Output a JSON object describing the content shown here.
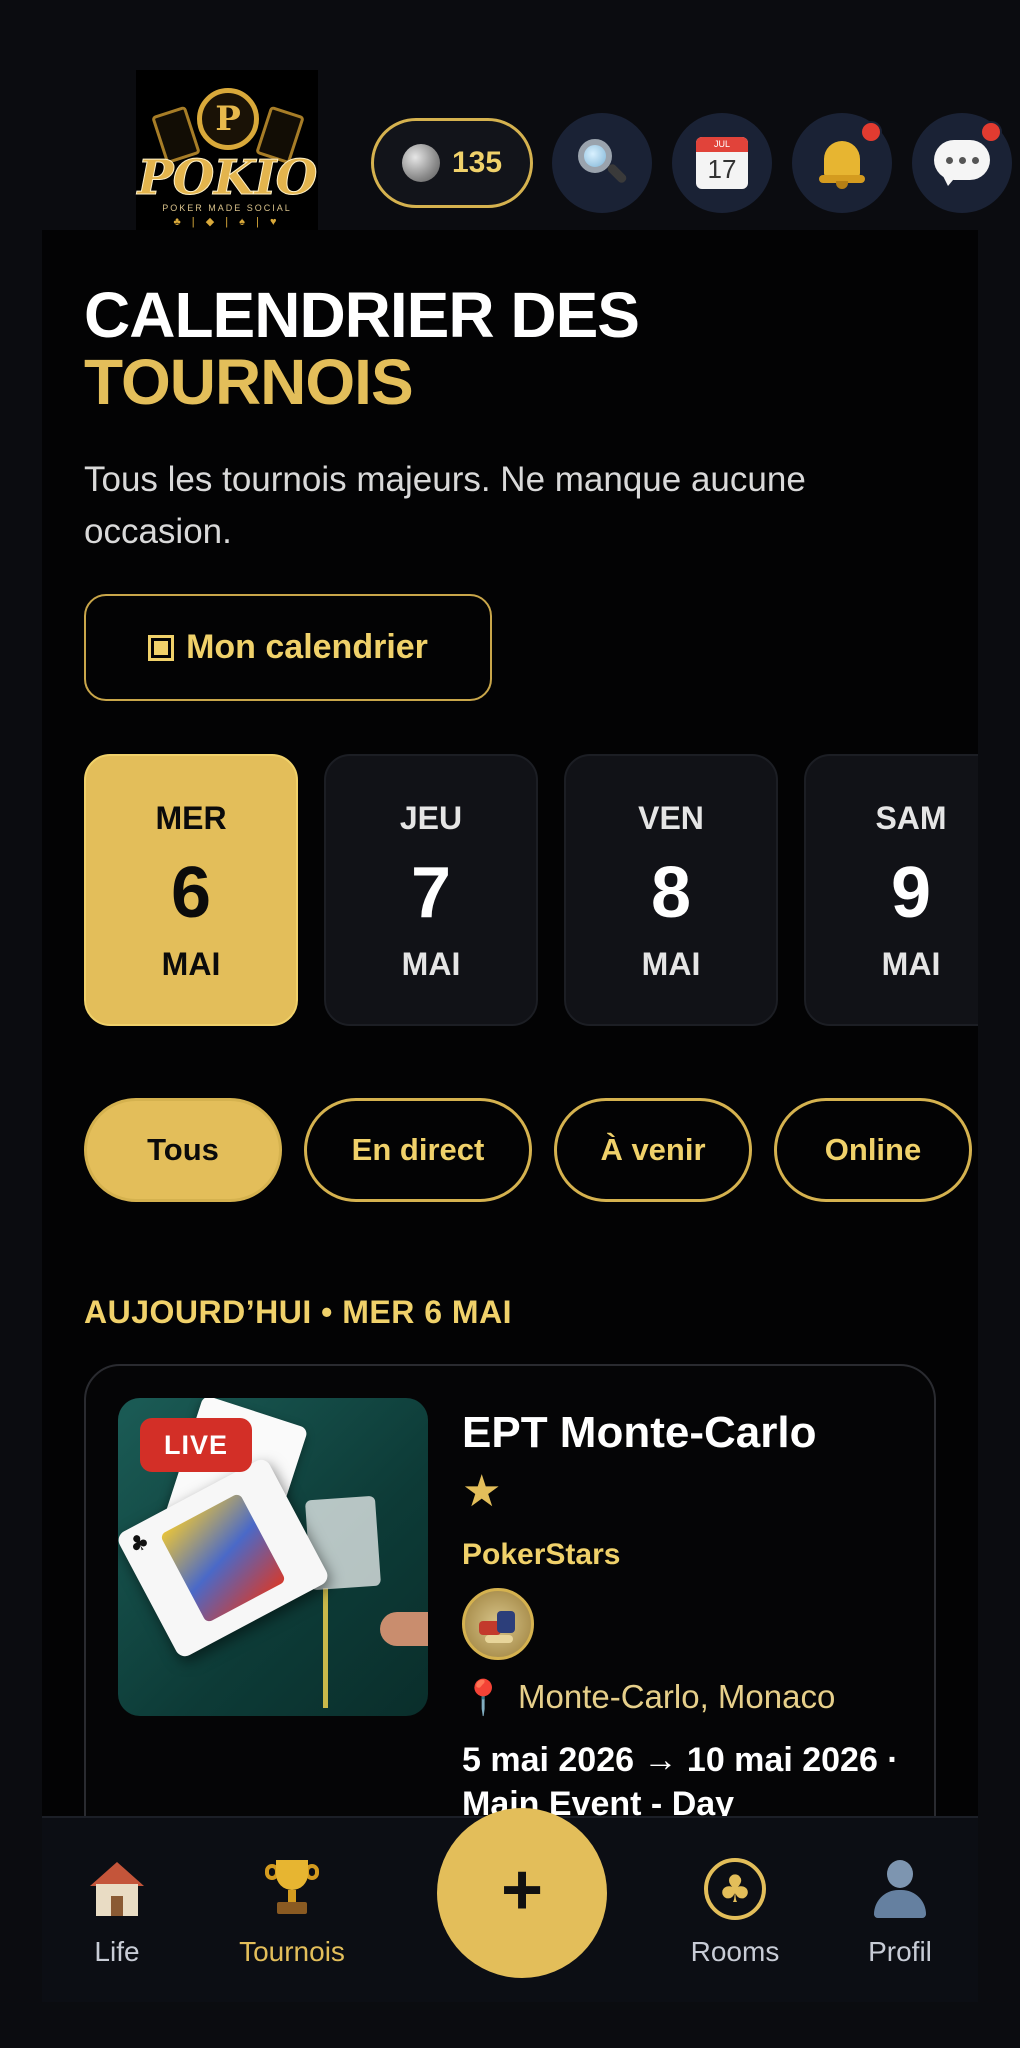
{
  "header": {
    "logo": {
      "chip_letter": "P",
      "wordmark": "POKIO",
      "tagline": "POKER MADE SOCIAL"
    },
    "coins": {
      "amount": "135",
      "icon": "coin-icon"
    },
    "buttons": [
      {
        "icon": "search-icon"
      },
      {
        "icon": "calendar-icon",
        "month": "JUL",
        "day": "17"
      },
      {
        "icon": "bell-icon",
        "has_badge": true
      },
      {
        "icon": "chat-bubble-icon",
        "has_badge": true
      }
    ],
    "badge_color": "#e23b30"
  },
  "page": {
    "title_line1": "CALENDRIER DES",
    "title_line2": "TOURNOIS",
    "subtitle": "Tous les tournois majeurs. Ne manque aucune occasion.",
    "my_calendar_button": "Mon calendrier"
  },
  "days": [
    {
      "dow": "MER",
      "num": "6",
      "month": "MAI",
      "selected": true
    },
    {
      "dow": "JEU",
      "num": "7",
      "month": "MAI",
      "selected": false
    },
    {
      "dow": "VEN",
      "num": "8",
      "month": "MAI",
      "selected": false
    },
    {
      "dow": "SAM",
      "num": "9",
      "month": "MAI",
      "selected": false
    }
  ],
  "filters": [
    {
      "label": "Tous",
      "active": true
    },
    {
      "label": "En direct",
      "active": false
    },
    {
      "label": "À venir",
      "active": false
    },
    {
      "label": "Online",
      "active": false
    }
  ],
  "section_heading": "AUJOURD’HUI • MER 6 MAI",
  "event": {
    "status_badge": "LIVE",
    "title": "EPT Monte-Carlo",
    "star": "★",
    "operator": "PokerStars",
    "location": "Monte-Carlo, Monaco",
    "dates": "5 mai 2026 → 10 mai 2026 · Main Event - Day"
  },
  "nav": {
    "items": [
      {
        "label": "Life",
        "icon": "house-icon"
      },
      {
        "label": "Tournois",
        "icon": "trophy-icon",
        "active": true
      },
      {
        "label": "Rooms",
        "icon": "clubs-icon"
      },
      {
        "label": "Profil",
        "icon": "person-icon"
      }
    ],
    "fab_label": "+"
  },
  "colors": {
    "accent_gold": "#e3be5a",
    "gold_text": "#f0d16a",
    "background": "#0b0c10",
    "live_red": "#d32f27"
  }
}
